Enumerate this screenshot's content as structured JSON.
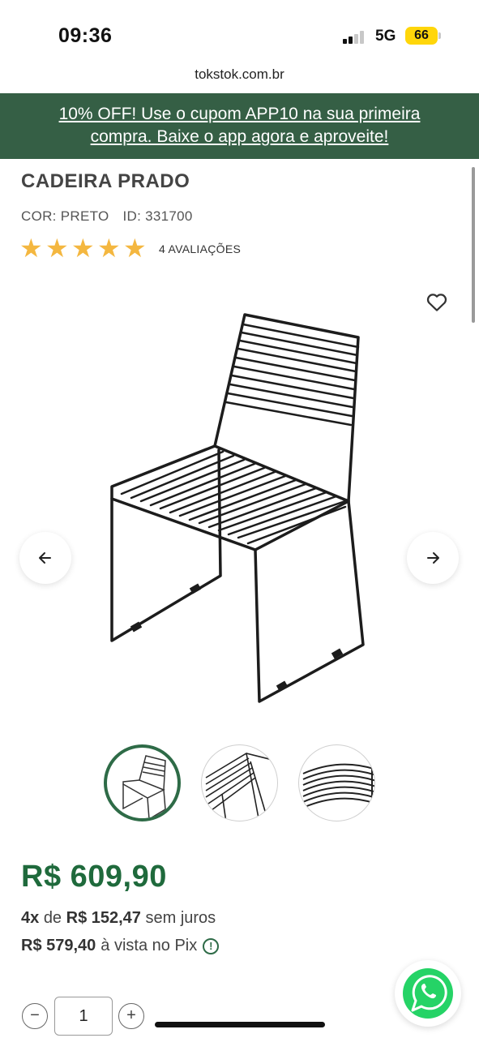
{
  "status_bar": {
    "time": "09:36",
    "network": "5G",
    "battery": "66"
  },
  "browser": {
    "url": "tokstok.com.br"
  },
  "promo": {
    "line1": "10% OFF! Use o cupom APP10 na sua primeira",
    "line2": "compra. Baixe o app agora e aproveite!"
  },
  "product": {
    "name": "CADEIRA PRADO",
    "color": "COR: PRETO",
    "id": "ID: 331700",
    "rating": 5,
    "reviews": "4 AVALIAÇÕES"
  },
  "gallery": {
    "thumbnail_count": 3,
    "active_index": 0
  },
  "pricing": {
    "price": "R$ 609,90",
    "installments_count": "4x",
    "installments_de": "de",
    "installment_value": "R$ 152,47",
    "installments_suffix": "sem juros",
    "pix_price": "R$ 579,40",
    "pix_suffix": "à vista no Pix"
  },
  "quantity": {
    "value": "1",
    "minus": "−",
    "plus": "+"
  },
  "icons": {
    "heart": "heart-icon",
    "prev": "arrow-left-icon",
    "next": "arrow-right-icon",
    "info": "info-icon",
    "whatsapp": "whatsapp-icon",
    "star": "star-icon"
  },
  "colors": {
    "brand_green": "#355f45",
    "price_green": "#1f6a3c",
    "star_yellow": "#f4b740",
    "whatsapp_green": "#25d366"
  }
}
